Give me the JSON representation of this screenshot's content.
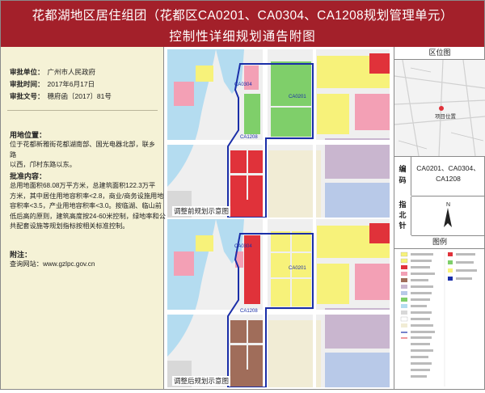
{
  "header": {
    "title_line1": "花都湖地区居住组团（花都区CA0201、CA0304、CA1208规划管理单元）",
    "title_line2": "控制性详细规划通告附图"
  },
  "info": {
    "unit_label": "审批单位：",
    "unit_value": "广州市人民政府",
    "time_label": "审批时间：",
    "time_value": "2017年6月17日",
    "doc_label": "审批文号：",
    "doc_value": "穗府函〔2017〕81号"
  },
  "location": {
    "label": "用地位置：",
    "text_l1": "位于花都新雅街花都湖南部、国光电器北部，联乡路",
    "text_l2": "以西，邝村东路以东。"
  },
  "approval": {
    "label": "批准内容：",
    "lines": [
      "总用地面积68.08万平方米，总建筑面积122.3万平",
      "方米，其中居住用地容积率<2.8，商业/商务设施用地",
      "容积率<3.5，产业用地容积率<3.0。按临湖、临山前",
      "低后高的原则，建筑高度按24-60米控制，绿地率和公",
      "共配套设施等规划指标按相关标准控制。"
    ]
  },
  "notes": {
    "label": "附注：",
    "text": "查询网站：www.gzlpc.gov.cn"
  },
  "maps": {
    "before_caption": "调整前规划示意图",
    "after_caption": "调整后规划示意图",
    "unit_a": "CA0304",
    "unit_b": "CA0201",
    "unit_c": "CA1208"
  },
  "sidebar": {
    "location_title": "区位图",
    "project_label": "项目位置",
    "code_label": "编码",
    "code_value": "CA0201、CA0304、CA1208",
    "north_label": "指北针",
    "north_letter": "N",
    "legend_title": "图例"
  },
  "colors": {
    "header_bg": "#a3202a",
    "left_bg": "#f5f2d6",
    "boundary": "#1a2ea8",
    "green": "#7fcf6a",
    "yellow": "#f7f27a",
    "red": "#e0323a",
    "pink": "#f3a0b5",
    "brown": "#a06d5a",
    "water": "#b4dcf0"
  }
}
